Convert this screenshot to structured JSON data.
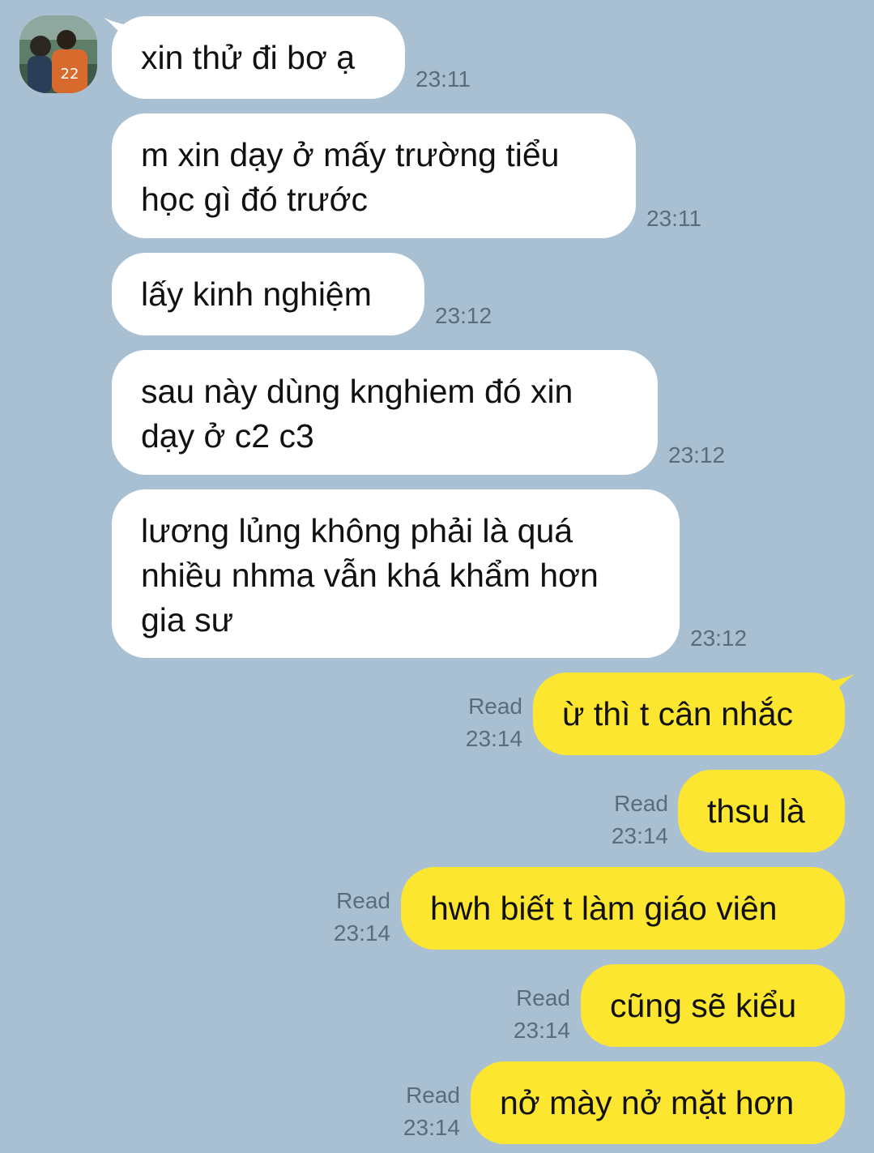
{
  "contact": {
    "avatar_icon": "profile-photo-icon"
  },
  "messages_in": [
    {
      "text": "xin thử đi bơ ạ",
      "time": "23:11"
    },
    {
      "text": "m xin dạy ở mấy trường tiểu\nhọc gì đó trước",
      "time": "23:11"
    },
    {
      "text": "lấy kinh nghiệm",
      "time": "23:12"
    },
    {
      "text": "sau này dùng knghiem đó xin\ndạy ở c2 c3",
      "time": "23:12"
    },
    {
      "text": "lương lủng không phải là quá\nnhiều nhma vẫn khá khẩm hơn\ngia sư",
      "time": "23:12"
    }
  ],
  "messages_out": [
    {
      "text": "ừ thì t cân nhắc",
      "status": "Read",
      "time": "23:14"
    },
    {
      "text": "thsu là",
      "status": "Read",
      "time": "23:14"
    },
    {
      "text": "hwh biết t làm giáo viên",
      "status": "Read",
      "time": "23:14"
    },
    {
      "text": "cũng sẽ kiểu",
      "status": "Read",
      "time": "23:14"
    },
    {
      "text": "nở mày nở mặt hơn",
      "status": "Read",
      "time": "23:14"
    }
  ],
  "colors": {
    "background": "#a9c0d2",
    "incoming_bubble": "#ffffff",
    "outgoing_bubble": "#fde630",
    "meta_text": "#5b6c7b"
  }
}
